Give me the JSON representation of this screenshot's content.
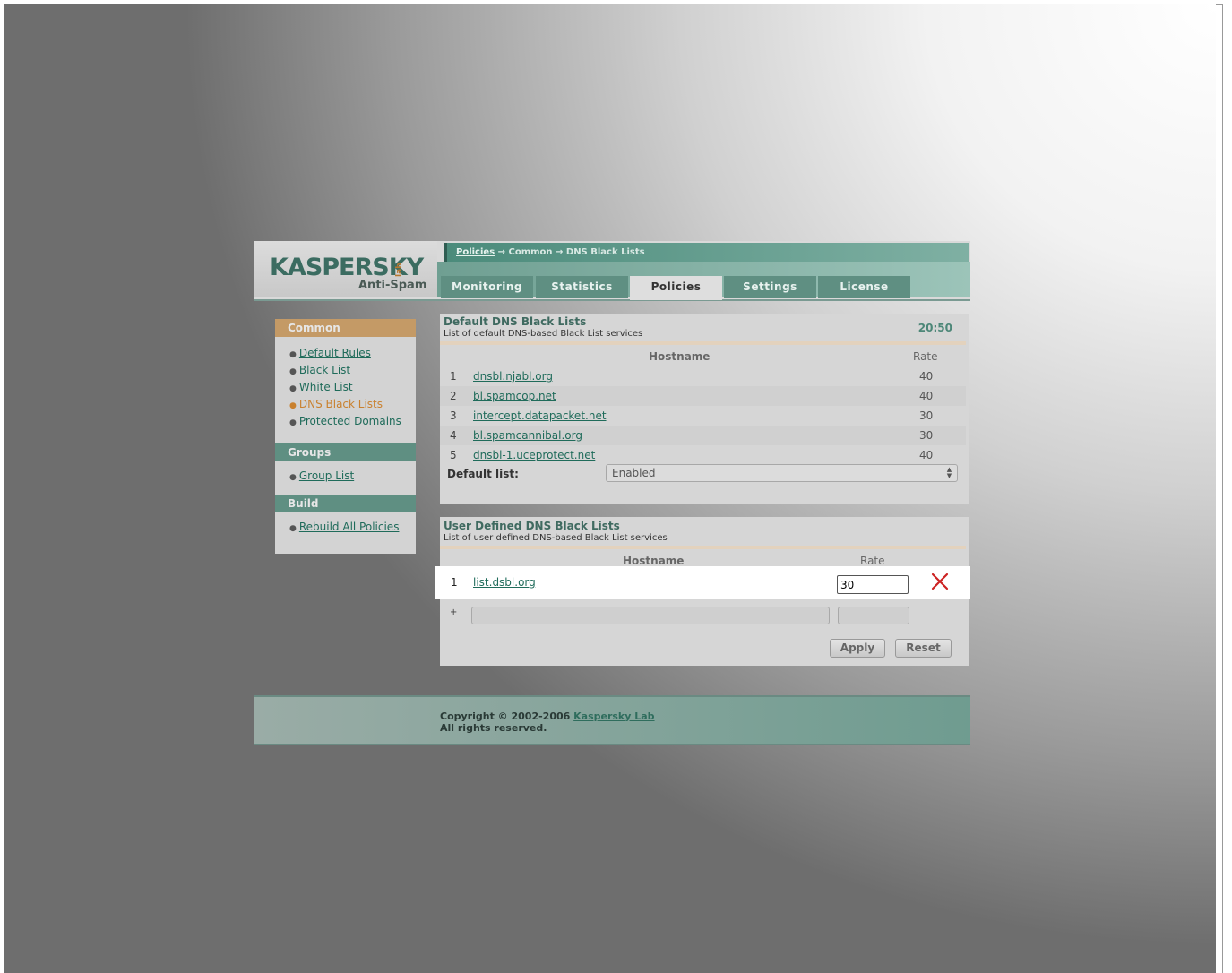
{
  "logo": {
    "brand": "KASPERSKY",
    "lab": "lab",
    "product": "Anti-Spam"
  },
  "breadcrumb": {
    "link": "Policies",
    "sep1": " → ",
    "mid": "Common",
    "sep2": " → ",
    "current": "DNS Black Lists"
  },
  "tabs": [
    {
      "label": "Monitoring",
      "active": false
    },
    {
      "label": "Statistics",
      "active": false
    },
    {
      "label": "Policies",
      "active": true
    },
    {
      "label": "Settings",
      "active": false
    },
    {
      "label": "License",
      "active": false
    }
  ],
  "sidebar": {
    "common_header": "Common",
    "common_items": [
      {
        "label": "Default Rules"
      },
      {
        "label": "Black List"
      },
      {
        "label": "White List"
      },
      {
        "label": "DNS Black Lists",
        "current": true
      },
      {
        "label": "Protected Domains"
      }
    ],
    "groups_header": "Groups",
    "groups_items": [
      {
        "label": "Group List"
      }
    ],
    "build_header": "Build",
    "build_items": [
      {
        "label": "Rebuild All Policies"
      }
    ]
  },
  "default_section": {
    "title": "Default DNS Black Lists",
    "subtitle": "List of default DNS-based Black List services",
    "clock": "20:50",
    "col_hostname": "Hostname",
    "col_rate": "Rate",
    "rows": [
      {
        "num": "1",
        "hostname": "dnsbl.njabl.org",
        "rate": "40"
      },
      {
        "num": "2",
        "hostname": "bl.spamcop.net",
        "rate": "40"
      },
      {
        "num": "3",
        "hostname": "intercept.datapacket.net",
        "rate": "30"
      },
      {
        "num": "4",
        "hostname": "bl.spamcannibal.org",
        "rate": "30"
      },
      {
        "num": "5",
        "hostname": "dnsbl-1.uceprotect.net",
        "rate": "40"
      }
    ],
    "default_list_label": "Default list:",
    "default_list_value": "Enabled"
  },
  "user_section": {
    "title": "User Defined DNS Black Lists",
    "subtitle": "List of user defined DNS-based Black List services",
    "col_hostname": "Hostname",
    "col_rate": "Rate",
    "rows": [
      {
        "num": "1",
        "hostname": "list.dsbl.org",
        "rate": "30"
      }
    ],
    "add_marker": "+",
    "apply_label": "Apply",
    "reset_label": "Reset"
  },
  "footer": {
    "copyright": "Copyright © 2002-2006 ",
    "company": "Kaspersky Lab",
    "rights": "All rights reserved."
  },
  "colors": {
    "accent": "#5f8f82",
    "orange": "#c49a66",
    "delete": "#cc2222"
  }
}
